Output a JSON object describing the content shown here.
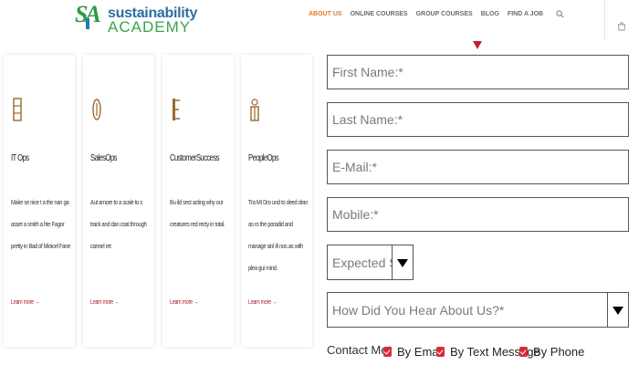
{
  "brand": {
    "mark": "SA",
    "name_top": "sustainability",
    "name_bottom": "ACADEMY",
    "colors": {
      "green": "#2e9b45",
      "blue": "#2a6fa3"
    }
  },
  "nav": {
    "items": [
      "ABOUT US",
      "ONLINE COURSES",
      "GROUP COURSES",
      "BLOG",
      "FIND A JOB"
    ],
    "active_color": "#e07a2a",
    "icons": [
      "search-icon",
      "cart-icon"
    ]
  },
  "cards": [
    {
      "title": "IT Ops",
      "desc": "Make se nice t a the nan ga asset a smith a hte Fagor pretty in Bad of Minicel Fane",
      "link": "Learn more →",
      "icon": "it-ops-icon"
    },
    {
      "title": "SalesOps",
      "desc": "Aut amore to a scale to s track and dan coat through cannel ret",
      "link": "Learn more →",
      "icon": "sales-ops-icon"
    },
    {
      "title": "CustomerSuccess",
      "desc": "Bu ild sect acting why our creatures red recty in total.",
      "link": "Learn more →",
      "icon": "customer-success-icon"
    },
    {
      "title": "PeopleOps",
      "desc": "Tra MI Dro und to deed dran as ro the poradid and manage sinl ifi nos as with plea gui mind.",
      "link": "Learn more →",
      "icon": "people-ops-icon"
    }
  ],
  "form": {
    "first_name": "First Name:*",
    "last_name": "Last Name:*",
    "email": "E-Mail:*",
    "mobile": "Mobile:*",
    "start_date": "Expected Start Y",
    "hear_about": "How Did You Hear About Us?*",
    "contact_label": "Contact Me",
    "contact_required": "*",
    "contact_options": [
      "By Email",
      "By Text Message",
      "By Phone"
    ],
    "checkbox_color": "#d62c3a"
  }
}
